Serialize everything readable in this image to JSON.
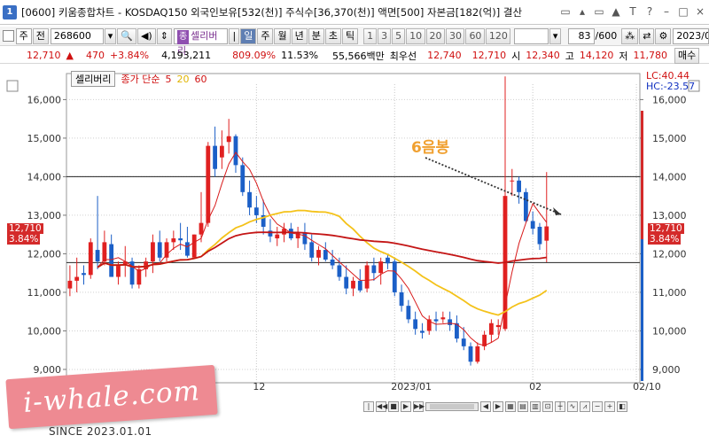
{
  "window": {
    "number": "1",
    "title": "[0600] 키움종합차트 - KOSDAQ150 외국인보유[532(천)] 주식수[36,370(천)] 액면[500] 자본금[182(억)] 결산",
    "controls": [
      "□",
      "▲",
      "□",
      "▲",
      "T",
      "?",
      "-",
      "□",
      "×"
    ]
  },
  "toolbar": {
    "period_select": "주",
    "prev_label": "전",
    "code": "268600",
    "stock_tag_prefix": "종",
    "stock_name": "셀리버리",
    "intervals": [
      "일",
      "주",
      "월",
      "년",
      "분",
      "초",
      "틱"
    ],
    "active_interval": "일",
    "minute_options": [
      "1",
      "3",
      "5",
      "10",
      "20",
      "30",
      "60",
      "120"
    ],
    "count_value": "83",
    "count_total": "/600",
    "date_value": "2023/0"
  },
  "quote": {
    "price": "12,710",
    "arrow": "▲",
    "change": "470",
    "change_pct": "+3.84%",
    "volume": "4,193,211",
    "turnover_pct": "809.09%",
    "rate2": "11.53%",
    "amount": "55,566백만",
    "priority_label": "최우선",
    "best_ask": "12,740",
    "best_bid": "12,710",
    "open_label": "시",
    "open": "12,340",
    "high_label": "고",
    "high": "14,120",
    "low_label": "저",
    "low": "11,780",
    "trade_button": "매수"
  },
  "legend": {
    "stock": "셀리버리",
    "ma_label": "종가 단순",
    "ma_periods": [
      "5",
      "20",
      "60"
    ]
  },
  "right_labels": {
    "lc": "LC:40.44",
    "hc": "HC:-23.57",
    "price_box": "12,710",
    "pct_box": "3.84%"
  },
  "annotation": "6음봉",
  "chart_data": {
    "type": "candlestick",
    "ylim": [
      8700,
      16400
    ],
    "y_ticks": [
      9000,
      10000,
      11000,
      12000,
      13000,
      14000,
      15000,
      16000
    ],
    "y_tick_labels": [
      "9,000",
      "10,000",
      "11,000",
      "12,000",
      "13,000",
      "14,000",
      "15,000",
      "16,000"
    ],
    "x_labels": [
      {
        "label": "12",
        "index": 27
      },
      {
        "label": "2023/01",
        "index": 47
      },
      {
        "label": "02",
        "index": 67
      },
      {
        "label": "02/10",
        "index": 82
      }
    ],
    "horizontal_lines": [
      14000,
      11770
    ],
    "candles": [
      [
        11100,
        11700,
        10900,
        11300
      ],
      [
        11300,
        11900,
        11000,
        11400
      ],
      [
        11500,
        11700,
        11200,
        11450
      ],
      [
        11450,
        12400,
        11350,
        12300
      ],
      [
        12100,
        13500,
        11600,
        11800
      ],
      [
        11800,
        12600,
        11700,
        12300
      ],
      [
        12250,
        12500,
        11400,
        11400
      ],
      [
        11400,
        11800,
        11200,
        11700
      ],
      [
        11700,
        12200,
        11400,
        11800
      ],
      [
        11800,
        11900,
        11100,
        11200
      ],
      [
        11200,
        11700,
        11100,
        11600
      ],
      [
        11600,
        11900,
        11400,
        11800
      ],
      [
        11800,
        12500,
        11500,
        12300
      ],
      [
        12300,
        12600,
        11800,
        11900
      ],
      [
        11900,
        12400,
        11800,
        12300
      ],
      [
        12300,
        12600,
        12100,
        12400
      ],
      [
        12400,
        12800,
        12100,
        12350
      ],
      [
        12300,
        12700,
        11900,
        11950
      ],
      [
        11900,
        12500,
        11900,
        12500
      ],
      [
        12500,
        13600,
        12300,
        12800
      ],
      [
        12800,
        14900,
        12700,
        14800
      ],
      [
        14800,
        15300,
        14000,
        14200
      ],
      [
        14500,
        15200,
        14200,
        14800
      ],
      [
        14900,
        15500,
        14600,
        15050
      ],
      [
        15050,
        15100,
        14100,
        14300
      ],
      [
        14300,
        14500,
        13500,
        13600
      ],
      [
        13600,
        13900,
        13000,
        13200
      ],
      [
        13200,
        13500,
        12800,
        13000
      ],
      [
        13000,
        13400,
        12500,
        12700
      ],
      [
        12600,
        12900,
        12300,
        12450
      ],
      [
        12400,
        12700,
        12200,
        12500
      ],
      [
        12500,
        12800,
        12300,
        12650
      ],
      [
        12650,
        12800,
        12350,
        12400
      ],
      [
        12400,
        12700,
        12150,
        12550
      ],
      [
        12550,
        12800,
        12100,
        12250
      ],
      [
        12300,
        12500,
        11800,
        11900
      ],
      [
        11900,
        12200,
        11700,
        12100
      ],
      [
        12100,
        12300,
        11800,
        11850
      ],
      [
        11850,
        12100,
        11600,
        11700
      ],
      [
        11700,
        11900,
        11300,
        11400
      ],
      [
        11400,
        11700,
        10950,
        11100
      ],
      [
        11100,
        11400,
        10900,
        11300
      ],
      [
        11300,
        11600,
        11000,
        11050
      ],
      [
        11100,
        11800,
        11000,
        11700
      ],
      [
        11700,
        11900,
        11300,
        11500
      ],
      [
        11500,
        11900,
        11200,
        11800
      ],
      [
        11900,
        12000,
        11600,
        11750
      ],
      [
        11800,
        11900,
        10900,
        11000
      ],
      [
        11000,
        11200,
        10500,
        10650
      ],
      [
        10650,
        10800,
        10200,
        10300
      ],
      [
        10300,
        10500,
        9900,
        10050
      ],
      [
        10000,
        10200,
        9800,
        9950
      ],
      [
        10000,
        10400,
        9900,
        10300
      ],
      [
        10300,
        10500,
        10000,
        10250
      ],
      [
        10300,
        10500,
        10200,
        10350
      ],
      [
        10300,
        10500,
        10000,
        10150
      ],
      [
        10200,
        10400,
        9700,
        9800
      ],
      [
        9800,
        10100,
        9500,
        9600
      ],
      [
        9600,
        9700,
        9100,
        9200
      ],
      [
        9200,
        9700,
        9150,
        9600
      ],
      [
        9600,
        10000,
        9500,
        9900
      ],
      [
        9900,
        10300,
        9700,
        10200
      ],
      [
        10100,
        10300,
        9900,
        10150
      ],
      [
        10050,
        16600,
        10000,
        13500
      ],
      [
        13900,
        14200,
        13500,
        13900
      ],
      [
        13900,
        14000,
        13300,
        13600
      ],
      [
        13600,
        13700,
        12800,
        12850
      ],
      [
        12850,
        13100,
        12500,
        12650
      ],
      [
        12700,
        12800,
        12100,
        12250
      ],
      [
        12340,
        14120,
        11780,
        12710
      ]
    ],
    "x_offset": 0,
    "ma_series": [
      {
        "period": "5",
        "color": "#d81b1b"
      },
      {
        "period": "20",
        "color": "#f4c21a"
      },
      {
        "period": "60",
        "color": "#c41515"
      }
    ]
  }
}
